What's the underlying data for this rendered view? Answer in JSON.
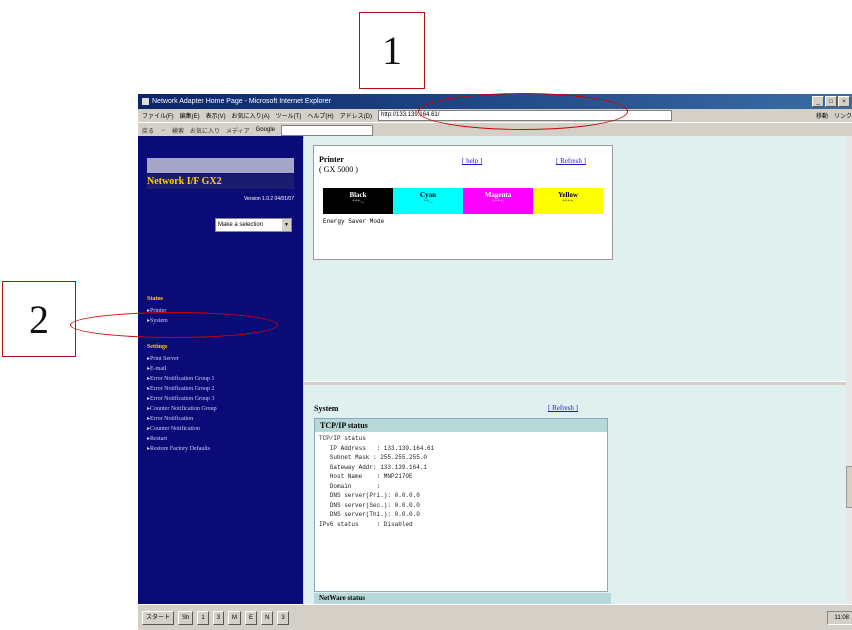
{
  "callouts": {
    "one": "1",
    "two": "2"
  },
  "browser": {
    "title": "Network Adapter Home Page - Microsoft Internet Explorer",
    "window_buttons": [
      "_",
      "□",
      "×"
    ],
    "menu": [
      "ファイル(F)",
      "編集(E)",
      "表示(V)",
      "お気に入り(A)",
      "ツール(T)",
      "ヘルプ(H)"
    ],
    "address_label": "アドレス(D)",
    "address": "http://133.139.164.61/",
    "go_label": "移動",
    "links_label": "リンク",
    "toolbar": [
      "戻る",
      "→",
      "検索",
      "お気に入り",
      "メディア"
    ],
    "google": "Google"
  },
  "sidebar": {
    "brand": "Network I/F GX2",
    "version": "Version 1.0.2 04/01/07",
    "select": "Make a selection",
    "status_head": "Status",
    "status_items": [
      "Printer",
      "System"
    ],
    "settings_head": "Settings",
    "settings_items": [
      "Print Server",
      "E-mail",
      "Error Notification Group 1",
      "Error Notification Group 2",
      "Error Notification Group 3",
      "Counter Notification Group",
      "Error Notification",
      "Counter Notification",
      "Restart",
      "Restore Factory Defaults"
    ]
  },
  "printer": {
    "title": "Printer",
    "model": "( GX 5000 )",
    "help": "[ help ]",
    "refresh": "[ Refresh ]",
    "inks": [
      {
        "name": "Black",
        "level": "+++._",
        "bg": "#000000",
        "fg": "#ffffff"
      },
      {
        "name": "Cyan",
        "level": "++._",
        "bg": "#00ffff",
        "fg": "#000000"
      },
      {
        "name": "Magenta",
        "level": "++++.",
        "bg": "#ff00ff",
        "fg": "#ffffff"
      },
      {
        "name": "Yellow",
        "level": "++++.",
        "bg": "#ffff00",
        "fg": "#000000"
      }
    ],
    "status": "Energy Saver Mode"
  },
  "system": {
    "title": "System",
    "refresh": "[ Refresh ]",
    "tcp_header": "TCP/IP status",
    "tcp_lines": [
      "TCP/IP status",
      "   IP Address   : 133.139.164.61",
      "   Subnet Mask : 255.255.255.0",
      "   Gateway Addr: 133.139.164.1",
      "   Host Name    : MNP2170E",
      "   Domain       :",
      "   DNS server(Pri.): 0.0.0.0",
      "   DNS server(Sec.): 0.0.0.0",
      "   DNS server(Thi.): 0.0.0.0",
      "",
      "IPv6 status     : Disabled"
    ],
    "netware_header": "NetWare status"
  },
  "taskbar": {
    "start": "スタート",
    "buttons": [
      "Sh",
      "1",
      "3",
      "M",
      "E",
      "N",
      "3"
    ],
    "clock": "11:08"
  }
}
